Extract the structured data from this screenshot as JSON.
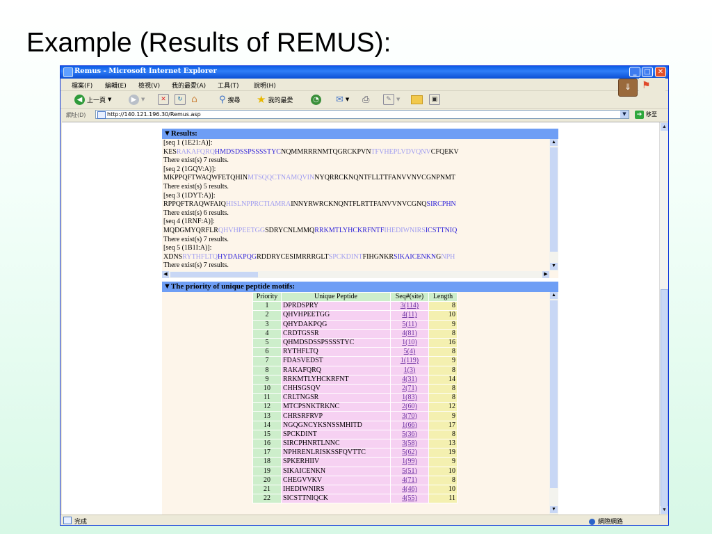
{
  "slide": {
    "title": "Example (Results of REMUS):"
  },
  "window": {
    "title": "Remus - Microsoft Internet Explorer",
    "menu": [
      "檔案(F)",
      "編輯(E)",
      "檢視(V)",
      "我的最愛(A)",
      "工具(T)",
      "說明(H)"
    ],
    "toolbar": {
      "back": "上一頁",
      "search": "搜尋",
      "favorites": "我的最愛"
    },
    "address_label": "網址(D)",
    "address": "http://140.121.196.30/Remus.asp",
    "go": "移至",
    "status": "完成",
    "zone": "網際網路"
  },
  "results": {
    "header": "▼Results:",
    "lines": [
      [
        [
          "blk",
          "[seq 1 (1E21:A)]:"
        ]
      ],
      [
        [
          "blk",
          "KES"
        ],
        [
          "lav",
          "RAKAFQRQ"
        ],
        [
          "blu",
          "HMDSDSSPSSSSTYC"
        ],
        [
          "blk",
          "NQMMRRRNMTQGRCKPVN"
        ],
        [
          "lav",
          "TFVHEPLVDVQNV"
        ],
        [
          "blk",
          "CFQEKV"
        ]
      ],
      [
        [
          "blk",
          "There exist(s) 7 results."
        ]
      ],
      [
        [
          "blk",
          "[seq 2 (1GQV:A)]:"
        ]
      ],
      [
        [
          "blk",
          "MKPPQFTWAQWFETQHIN"
        ],
        [
          "lav",
          "MTSQQCTNAMQVIN"
        ],
        [
          "blk",
          "NYQRRCKNQNTFLLTTFANVVNVCGNPNMT"
        ]
      ],
      [
        [
          "blk",
          "There exist(s) 5 results."
        ]
      ],
      [
        [
          "blk",
          "[seq 3 (1DYT:A)]:"
        ]
      ],
      [
        [
          "blk",
          "RPPQFTRAQWFAIQ"
        ],
        [
          "lav",
          "HISLNPPRCTIAMRA"
        ],
        [
          "blk",
          "INNYRWRCKNQNTFLRTTFANVVNVCGNQ"
        ],
        [
          "blu",
          "SIRCPHN"
        ]
      ],
      [
        [
          "blk",
          "There exist(s) 6 results."
        ]
      ],
      [
        [
          "blk",
          "[seq 4 (1RNF:A)]:"
        ]
      ],
      [
        [
          "blk",
          "MQDGMYQRFLR"
        ],
        [
          "lav",
          "QHVHPEETGG"
        ],
        [
          "blk",
          "SDRYCNLMMQ"
        ],
        [
          "blu",
          "RRKMTLYHCKRFNTF"
        ],
        [
          "lav",
          "IHEDIWNIRS"
        ],
        [
          "blu",
          "ICSTTNIQ"
        ]
      ],
      [
        [
          "blk",
          "There exist(s) 7 results."
        ]
      ],
      [
        [
          "blk",
          "[seq 5 (1B1I:A)]:"
        ]
      ],
      [
        [
          "blk",
          "XDNS"
        ],
        [
          "lav",
          "RYTHFLTQ"
        ],
        [
          "blu",
          "HYDAKPQG"
        ],
        [
          "blk",
          "RDDRYCESIMRRRGLT"
        ],
        [
          "lav",
          "SPCKDINT"
        ],
        [
          "blk",
          "FIHGNKR"
        ],
        [
          "blu",
          "SIKAICENKN"
        ],
        [
          "blk",
          "G"
        ],
        [
          "lav",
          "NPH"
        ]
      ],
      [
        [
          "blk",
          "There exist(s) 7 results."
        ]
      ]
    ]
  },
  "priority": {
    "header": "▼The priority of unique peptide motifs:",
    "columns": [
      "Priority",
      "Unique Peptide",
      "Seq#(site)",
      "Length"
    ],
    "rows": [
      [
        "1",
        "DPRDSPRY",
        "3(114)",
        "8"
      ],
      [
        "2",
        "QHVHPEETGG",
        "4(11)",
        "10"
      ],
      [
        "3",
        "QHYDAKPQG",
        "5(11)",
        "9"
      ],
      [
        "4",
        "CRDTGSSR",
        "4(81)",
        "8"
      ],
      [
        "5",
        "QHMDSDSSPSSSSTYC",
        "1(10)",
        "16"
      ],
      [
        "6",
        "RYTHFLTQ",
        "5(4)",
        "8"
      ],
      [
        "7",
        "FDASVEDST",
        "1(119)",
        "9"
      ],
      [
        "8",
        "RAKAFQRQ",
        "1(3)",
        "8"
      ],
      [
        "9",
        "RRKMTLYHCKRFNT",
        "4(31)",
        "14"
      ],
      [
        "10",
        "CHHSGSQV",
        "2(71)",
        "8"
      ],
      [
        "11",
        "CRLTNGSR",
        "1(83)",
        "8"
      ],
      [
        "12",
        "MTCPSNKTRKNC",
        "2(60)",
        "12"
      ],
      [
        "13",
        "CHRSRFRVP",
        "3(70)",
        "9"
      ],
      [
        "14",
        "NGQGNCYKSNSSMHITD",
        "1(66)",
        "17"
      ],
      [
        "15",
        "SPCKDINT",
        "5(36)",
        "8"
      ],
      [
        "16",
        "SIRCPHNRTLNNC",
        "3(58)",
        "13"
      ],
      [
        "17",
        "NPHRENLRISKSSFQVTTC",
        "5(62)",
        "19"
      ],
      [
        "18",
        "SPKERHIIV",
        "1(99)",
        "9"
      ],
      [
        "19",
        "SIKAICENKN",
        "5(51)",
        "10"
      ],
      [
        "20",
        "CHEGVVKV",
        "4(71)",
        "8"
      ],
      [
        "21",
        "IHEDIWNIRS",
        "4(46)",
        "10"
      ],
      [
        "22",
        "SICSTTNIQCK",
        "4(55)",
        "11"
      ]
    ]
  },
  "colors": {
    "header_blue": "#6e9ef5",
    "lavender": "#9f9cf0",
    "blue": "#2b1fd8",
    "panel_bg": "#fdf5ea"
  }
}
